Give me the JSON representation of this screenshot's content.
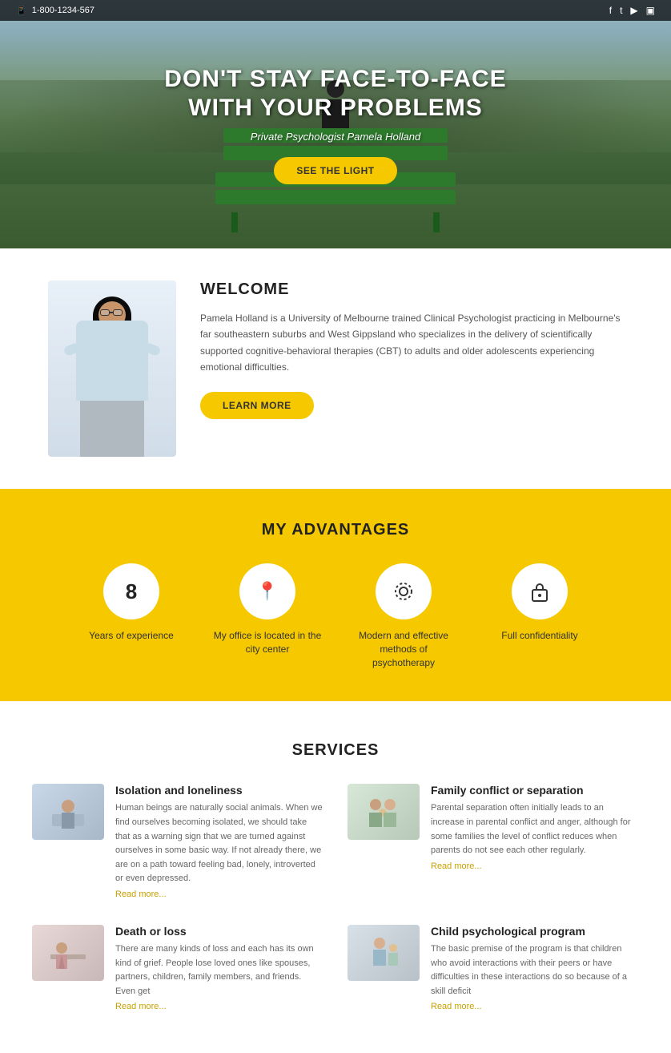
{
  "topbar": {
    "phone": "1-800-1234-567",
    "social_icons": [
      "f",
      "t",
      "▶",
      "📷"
    ]
  },
  "hero": {
    "title_line1": "DON'T STAY FACE-TO-FACE",
    "title_line2": "WITH YOUR PROBLEMS",
    "subtitle": "Private Psychologist Pamela Holland",
    "cta_button": "SEE THE LIGHT"
  },
  "welcome": {
    "title": "WELCOME",
    "description": "Pamela Holland is a University of Melbourne trained Clinical Psychologist practicing in Melbourne's far southeastern suburbs and West Gippsland who specializes in the delivery of scientifically supported cognitive-behavioral therapies (CBT) to adults and older adolescents experiencing emotional difficulties.",
    "button": "LEARN MORE"
  },
  "advantages": {
    "title": "MY ADVANTAGES",
    "items": [
      {
        "icon": "8",
        "label": "Years of experience"
      },
      {
        "icon": "📍",
        "label": "My office is located in the city center"
      },
      {
        "icon": "⚙",
        "label": "Modern and effective methods of psychotherapy"
      },
      {
        "icon": "🔒",
        "label": "Full confidentiality"
      }
    ]
  },
  "services": {
    "title": "SERVICES",
    "items": [
      {
        "name": "Isolation and loneliness",
        "description": "Human beings are naturally social animals. When we find ourselves becoming isolated, we should take that as a warning sign that we are turned against ourselves in some basic way. If not already there, we are on a path toward feeling bad, lonely, introverted or even depressed.",
        "read_more": "Read more..."
      },
      {
        "name": "Family conflict or separation",
        "description": "Parental separation often initially leads to an increase in parental conflict and anger, although for some families the level of conflict reduces when parents do not see each other regularly.",
        "read_more": "Read more..."
      },
      {
        "name": "Death or loss",
        "description": "There are many kinds of loss and each has its own kind of grief. People lose loved ones like spouses, partners, children, family members, and friends. Even get",
        "read_more": "Read more..."
      },
      {
        "name": "Child psychological program",
        "description": "The basic premise of the program is that children who avoid interactions with their peers or have difficulties in these interactions do so because of a skill deficit",
        "read_more": "Read more..."
      }
    ]
  }
}
